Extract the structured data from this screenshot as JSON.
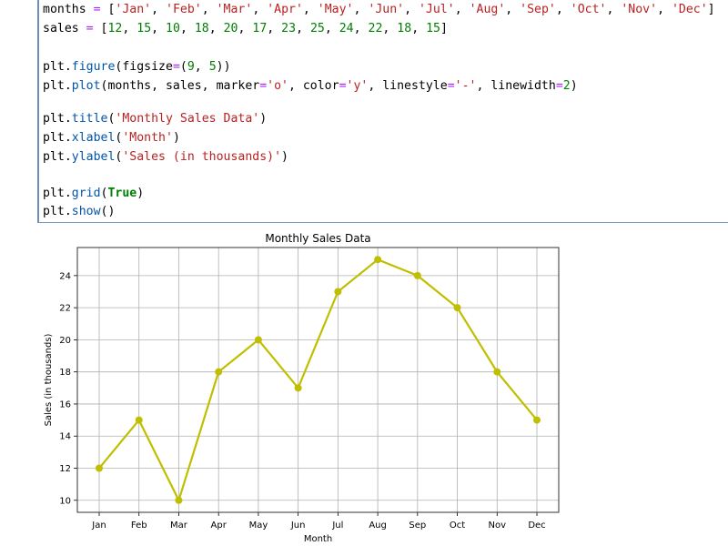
{
  "code_lines": [
    [
      [
        "months ",
        ""
      ],
      [
        "=",
        "op"
      ],
      [
        " [",
        ""
      ],
      [
        "'Jan'",
        "str"
      ],
      [
        ", ",
        ""
      ],
      [
        "'Feb'",
        "str"
      ],
      [
        ", ",
        ""
      ],
      [
        "'Mar'",
        "str"
      ],
      [
        ", ",
        ""
      ],
      [
        "'Apr'",
        "str"
      ],
      [
        ", ",
        ""
      ],
      [
        "'May'",
        "str"
      ],
      [
        ", ",
        ""
      ],
      [
        "'Jun'",
        "str"
      ],
      [
        ", ",
        ""
      ],
      [
        "'Jul'",
        "str"
      ],
      [
        ", ",
        ""
      ],
      [
        "'Aug'",
        "str"
      ],
      [
        ", ",
        ""
      ],
      [
        "'Sep'",
        "str"
      ],
      [
        ", ",
        ""
      ],
      [
        "'Oct'",
        "str"
      ],
      [
        ", ",
        ""
      ],
      [
        "'Nov'",
        "str"
      ],
      [
        ", ",
        ""
      ],
      [
        "'Dec'",
        "str"
      ],
      [
        "]",
        ""
      ]
    ],
    [
      [
        "sales ",
        ""
      ],
      [
        "=",
        "op"
      ],
      [
        " [",
        ""
      ],
      [
        "12",
        "num"
      ],
      [
        ", ",
        ""
      ],
      [
        "15",
        "num"
      ],
      [
        ", ",
        ""
      ],
      [
        "10",
        "num"
      ],
      [
        ", ",
        ""
      ],
      [
        "18",
        "num"
      ],
      [
        ", ",
        ""
      ],
      [
        "20",
        "num"
      ],
      [
        ", ",
        ""
      ],
      [
        "17",
        "num"
      ],
      [
        ", ",
        ""
      ],
      [
        "23",
        "num"
      ],
      [
        ", ",
        ""
      ],
      [
        "25",
        "num"
      ],
      [
        ", ",
        ""
      ],
      [
        "24",
        "num"
      ],
      [
        ", ",
        ""
      ],
      [
        "22",
        "num"
      ],
      [
        ", ",
        ""
      ],
      [
        "18",
        "num"
      ],
      [
        ", ",
        ""
      ],
      [
        "15",
        "num"
      ],
      [
        "]",
        ""
      ]
    ],
    [],
    [
      [
        "plt.",
        ""
      ],
      [
        "figure",
        "fn"
      ],
      [
        "(figsize",
        ""
      ],
      [
        "=",
        "op"
      ],
      [
        "(",
        ""
      ],
      [
        "9",
        "num"
      ],
      [
        ", ",
        ""
      ],
      [
        "5",
        "num"
      ],
      [
        "))",
        ""
      ]
    ],
    [
      [
        "plt.",
        ""
      ],
      [
        "plot",
        "fn"
      ],
      [
        "(months, sales, marker",
        ""
      ],
      [
        "=",
        "op"
      ],
      [
        "'o'",
        "str"
      ],
      [
        ", color",
        ""
      ],
      [
        "=",
        "op"
      ],
      [
        "'y'",
        "str"
      ],
      [
        ", linestyle",
        ""
      ],
      [
        "=",
        "op"
      ],
      [
        "'-'",
        "str"
      ],
      [
        ", linewidth",
        ""
      ],
      [
        "=",
        "op"
      ],
      [
        "2",
        "num"
      ],
      [
        ")",
        ""
      ]
    ],
    [],
    [
      [
        "plt.",
        ""
      ],
      [
        "title",
        "fn"
      ],
      [
        "(",
        ""
      ],
      [
        "'Monthly Sales Data'",
        "str"
      ],
      [
        ")",
        ""
      ]
    ],
    [
      [
        "plt.",
        ""
      ],
      [
        "xlabel",
        "fn"
      ],
      [
        "(",
        ""
      ],
      [
        "'Month'",
        "str"
      ],
      [
        ")",
        ""
      ]
    ],
    [
      [
        "plt.",
        ""
      ],
      [
        "ylabel",
        "fn"
      ],
      [
        "(",
        ""
      ],
      [
        "'Sales (in thousands)'",
        "str"
      ],
      [
        ")",
        ""
      ]
    ],
    [],
    [
      [
        "plt.",
        ""
      ],
      [
        "grid",
        "fn"
      ],
      [
        "(",
        ""
      ],
      [
        "True",
        "kw"
      ],
      [
        ")",
        ""
      ]
    ],
    [
      [
        "plt.",
        ""
      ],
      [
        "show",
        "fn"
      ],
      [
        "()",
        ""
      ]
    ]
  ],
  "chart_data": {
    "type": "line",
    "title": "Monthly Sales Data",
    "xlabel": "Month",
    "ylabel": "Sales (in thousands)",
    "categories": [
      "Jan",
      "Feb",
      "Mar",
      "Apr",
      "May",
      "Jun",
      "Jul",
      "Aug",
      "Sep",
      "Oct",
      "Nov",
      "Dec"
    ],
    "values": [
      12,
      15,
      10,
      18,
      20,
      17,
      23,
      25,
      24,
      22,
      18,
      15
    ],
    "yticks": [
      "10",
      "12",
      "14",
      "16",
      "18",
      "20",
      "22",
      "24"
    ],
    "ylim": [
      9.25,
      25.75
    ],
    "grid": true,
    "color": "#bfbf00",
    "marker": "o"
  }
}
